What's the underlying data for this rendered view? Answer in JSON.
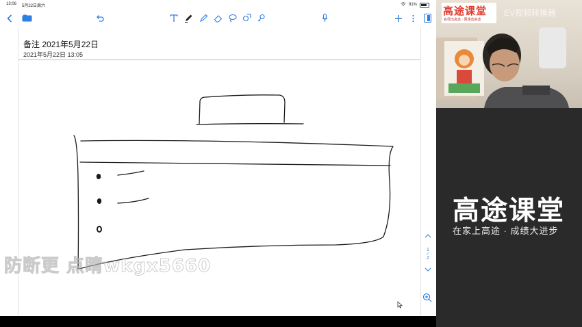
{
  "status_bar": {
    "time": "13:06",
    "date": "5月22日周六",
    "battery": "91%"
  },
  "toolbar": {
    "back_icon": "chevron-left-icon",
    "folders_icon": "folder-icon",
    "undo_icon": "undo-icon",
    "tools": [
      "text-tool-icon",
      "pen-tool-icon",
      "highlighter-tool-icon",
      "eraser-tool-icon",
      "lasso-tool-icon",
      "shapes-tool-icon",
      "link-tool-icon"
    ],
    "mic_icon": "microphone-icon",
    "add_icon": "plus-icon",
    "more_icon": "more-icon",
    "pages_icon": "pages-icon",
    "accent": "#2f7ee0"
  },
  "note": {
    "title": "备注 2021年5月22日",
    "created": "2021年5月22日 13:05"
  },
  "pager": {
    "current": "1",
    "total": "2"
  },
  "watermark": "防断更 点睛wkgx5660",
  "camera": {
    "logo": "高途课堂",
    "logo_sub": "名师出高途 · 网课选高途",
    "overlay": "EV视频转换器"
  },
  "brand_panel": {
    "name": "高途课堂",
    "slogan": "在家上高途 · 成绩大进步"
  }
}
